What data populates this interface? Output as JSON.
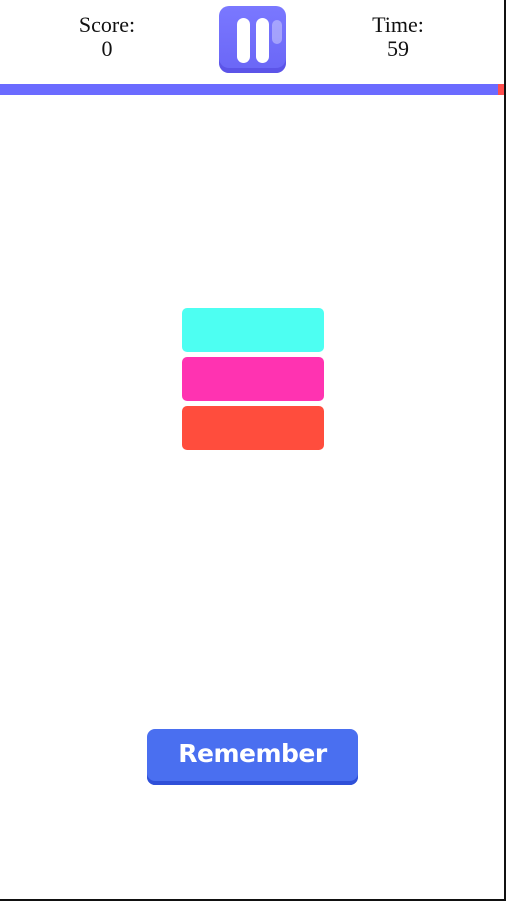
{
  "hud": {
    "score_label": "Score:",
    "score_value": "0",
    "time_label": "Time:",
    "time_value": "59",
    "pause_icon": "pause-icon",
    "timer_remaining_fraction": 0.988
  },
  "blocks": [
    {
      "color": "#4dfff2"
    },
    {
      "color": "#ff33b1"
    },
    {
      "color": "#ff4d3d"
    }
  ],
  "action": {
    "remember_label": "Remember"
  },
  "colors": {
    "accent": "#6b6bff",
    "button": "#4a6ff0",
    "timer_empty": "#ff4e4e"
  }
}
